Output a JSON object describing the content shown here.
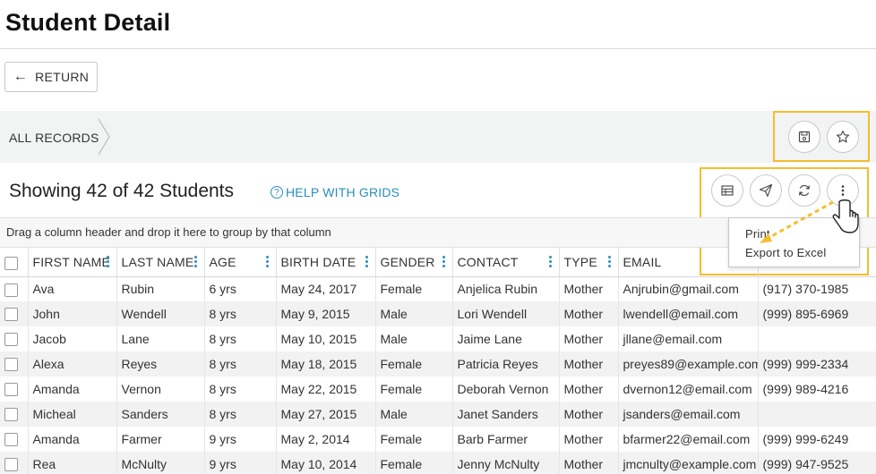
{
  "page": {
    "title": "Student Detail"
  },
  "toolbar": {
    "return_label": "RETURN"
  },
  "breadcrumb": {
    "label": "ALL RECORDS"
  },
  "header_actions": {
    "save_icon": "save-icon",
    "favorite_icon": "star-icon"
  },
  "grid_header": {
    "showing": "Showing 42 of 42 Students",
    "help_label": "HELP WITH GRIDS",
    "actions": [
      "columns-icon",
      "send-icon",
      "refresh-icon",
      "more-vertical-icon"
    ]
  },
  "group_hint": "Drag a column header and drop it here to group by that column",
  "menu": {
    "items": [
      "Print",
      "Export to Excel"
    ]
  },
  "columns": [
    "FIRST NAME",
    "LAST NAME",
    "AGE",
    "BIRTH DATE",
    "GENDER",
    "CONTACT",
    "TYPE",
    "EMAIL",
    ""
  ],
  "rows": [
    [
      "Ava",
      "Rubin",
      "6 yrs",
      "May 24, 2017",
      "Female",
      "Anjelica Rubin",
      "Mother",
      "Anjrubin@gmail.com",
      "(917) 370-1985"
    ],
    [
      "John",
      "Wendell",
      "8 yrs",
      "May 9, 2015",
      "Male",
      "Lori Wendell",
      "Mother",
      "lwendell@email.com",
      "(999) 895-6969"
    ],
    [
      "Jacob",
      "Lane",
      "8 yrs",
      "May 10, 2015",
      "Male",
      "Jaime Lane",
      "Mother",
      "jllane@email.com",
      ""
    ],
    [
      "Alexa",
      "Reyes",
      "8 yrs",
      "May 18, 2015",
      "Female",
      "Patricia Reyes",
      "Mother",
      "preyes89@example.com",
      "(999) 999-2334"
    ],
    [
      "Amanda",
      "Vernon",
      "8 yrs",
      "May 22, 2015",
      "Female",
      "Deborah Vernon",
      "Mother",
      "dvernon12@email.com",
      "(999) 989-4216"
    ],
    [
      "Micheal",
      "Sanders",
      "8 yrs",
      "May 27, 2015",
      "Male",
      "Janet Sanders",
      "Mother",
      "jsanders@email.com",
      ""
    ],
    [
      "Amanda",
      "Farmer",
      "9 yrs",
      "May 2, 2014",
      "Female",
      "Barb Farmer",
      "Mother",
      "bfarmer22@email.com",
      "(999) 999-6249"
    ],
    [
      "Rea",
      "McNulty",
      "9 yrs",
      "May 10, 2014",
      "Female",
      "Jenny McNulty",
      "Mother",
      "jmcnulty@example.com",
      "(999) 947-9525"
    ]
  ],
  "colors": {
    "accent": "#2a8fbd",
    "highlight": "#f5bd2e",
    "band": "#f2f3f3"
  }
}
